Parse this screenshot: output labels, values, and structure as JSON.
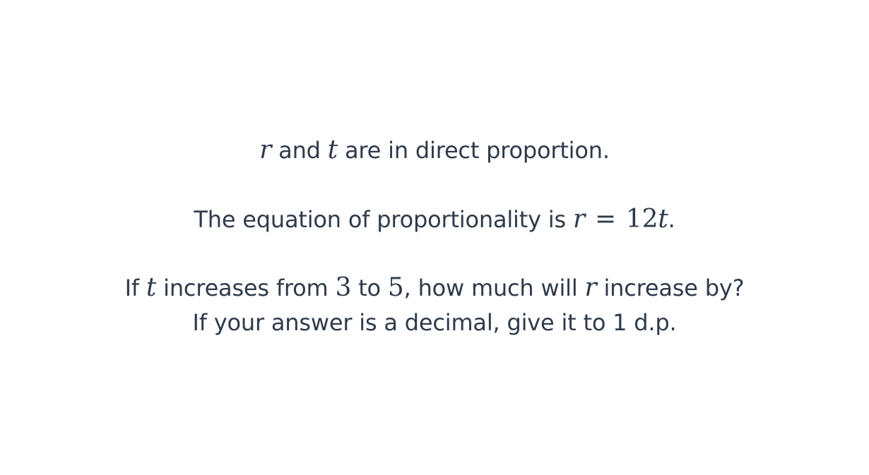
{
  "question": {
    "line1": {
      "var_a": "r",
      "text_a": " and ",
      "var_b": "t",
      "text_b": " are in direct proportion."
    },
    "line2": {
      "text_a": "The equation of proportionality is ",
      "var_a": "r",
      "equals": "=",
      "coefficient": "12",
      "var_b": "t",
      "text_b": "."
    },
    "line3": {
      "text_a": "If ",
      "var_a": "t",
      "text_b": " increases from ",
      "num_a": "3",
      "text_c": " to ",
      "num_b": "5",
      "text_d": ", how much will ",
      "var_b": "r",
      "text_e": " increase by?"
    },
    "line4": {
      "text": "If your answer is a decimal, give it to 1 d.p."
    }
  }
}
